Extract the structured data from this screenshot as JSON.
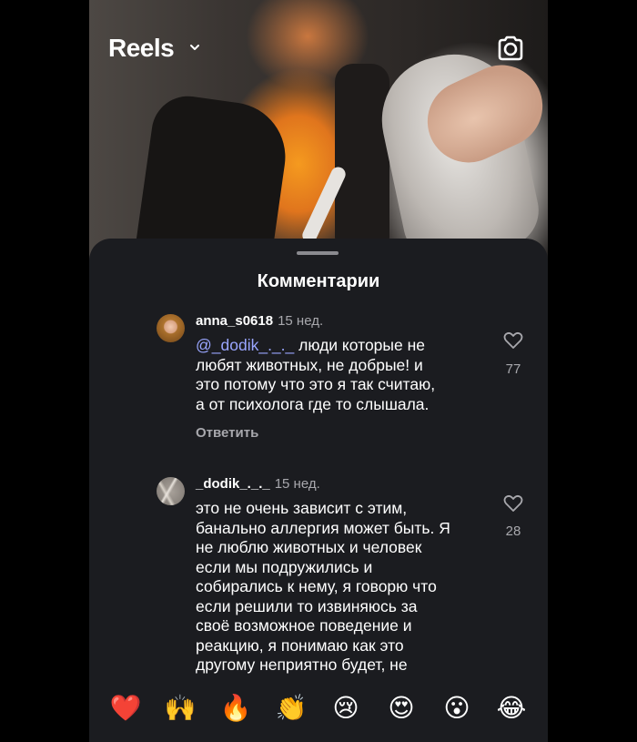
{
  "header": {
    "title": "Reels"
  },
  "comments_sheet": {
    "title": "Комментарии",
    "comments": [
      {
        "username": "anna_s0618",
        "time": "15 нед.",
        "mention": "@_dodik_._._",
        "text_lines": [
          " люди которые не",
          "любят животных, не добрые! и",
          "это потому что это я так считаю,",
          "а от психолога где то слышала."
        ],
        "reply_label": "Ответить",
        "likes": "77"
      },
      {
        "username": "_dodik_._._",
        "time": "15 нед.",
        "text_lines": [
          "это не очень зависит с этим,",
          "банально аллергия может быть. Я",
          "не люблю животных и человек",
          "если мы подружились и",
          "собирались к нему, я говорю что",
          "если решили то извиняюсь за",
          "своё возможное поведение и",
          "реакцию, я понимаю как это",
          "другому неприятно будет, не"
        ],
        "likes": "28"
      }
    ]
  },
  "emoji_bar": [
    "❤️",
    "🙌",
    "🔥",
    "👏",
    "😢",
    "😍",
    "😮",
    "😂"
  ],
  "colors": {
    "sheet_bg": "#1b1c20",
    "mention": "#9aa6ff",
    "secondary_text": "#a8a8ad"
  }
}
